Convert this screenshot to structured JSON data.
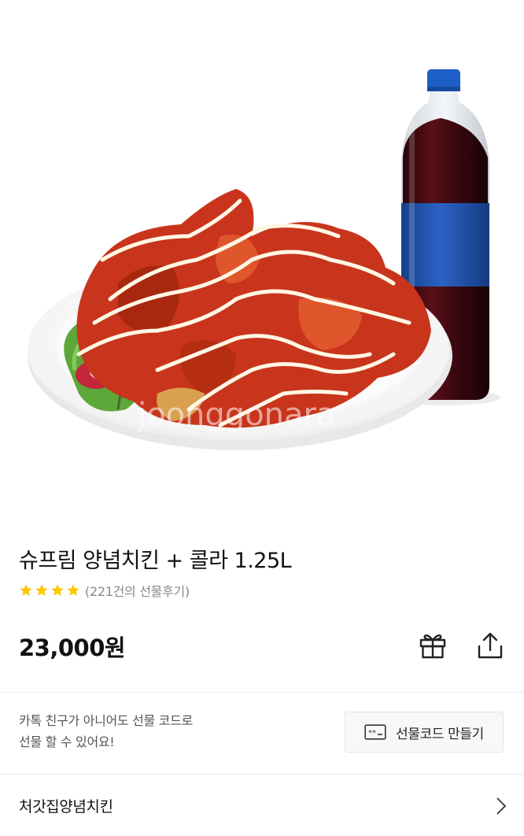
{
  "product": {
    "image_alt": "chicken-and-cola-photo",
    "watermark": "joonggonara",
    "title": "슈프림 양념치킨 + 콜라 1.25L",
    "rating_stars": 4,
    "review_text": "(221건의 선물후기)",
    "price": "23,000원"
  },
  "actions": {
    "gift_icon": "gift-icon",
    "share_icon": "share-icon"
  },
  "gift_code": {
    "line1": "카톡 친구가 아니어도 선물 코드로",
    "line2": "선물 할 수 있어요!",
    "button_label": "선물코드 만들기",
    "button_icon": "code-card-icon"
  },
  "store": {
    "name": "처갓집양념치킨"
  },
  "colors": {
    "star": "#FFC700",
    "sauce": "#D2381F",
    "cola_label": "#1D4FA8",
    "cola_cap": "#1E5FC7"
  }
}
